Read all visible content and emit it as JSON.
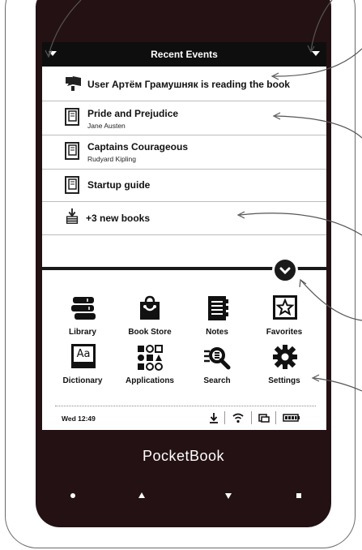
{
  "header": {
    "title": "Recent Events"
  },
  "events": [
    {
      "title": "User Артём Грамушняк is reading the book",
      "subtitle": "",
      "icon": "user-book-icon"
    },
    {
      "title": "Pride and Prejudice",
      "subtitle": "Jane Austen",
      "icon": "book-icon"
    },
    {
      "title": "Captains Courageous",
      "subtitle": "Rudyard Kipling",
      "icon": "book-icon"
    },
    {
      "title": "Startup guide",
      "subtitle": "",
      "icon": "book-icon"
    },
    {
      "title": "+3 new books",
      "subtitle": "",
      "icon": "download-icon"
    }
  ],
  "apps": [
    {
      "label": "Library",
      "icon": "library-icon"
    },
    {
      "label": "Book Store",
      "icon": "bookstore-icon"
    },
    {
      "label": "Notes",
      "icon": "notes-icon"
    },
    {
      "label": "Favorites",
      "icon": "favorites-icon"
    },
    {
      "label": "Dictionary",
      "icon": "dictionary-icon"
    },
    {
      "label": "Applications",
      "icon": "applications-icon"
    },
    {
      "label": "Search",
      "icon": "search-icon"
    },
    {
      "label": "Settings",
      "icon": "settings-icon"
    }
  ],
  "dictionary_glyph": "Aa",
  "status": {
    "time": "Wed 12:49"
  },
  "device": {
    "brand": "PocketBook"
  },
  "colors": {
    "device_body": "#241113",
    "topbar": "#0e0e0e",
    "text": "#111111"
  }
}
